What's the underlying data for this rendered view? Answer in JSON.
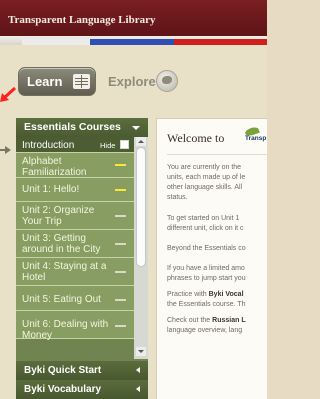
{
  "header": {
    "title": "Transparent Language Library"
  },
  "nav": {
    "learn_label": "Learn",
    "explore_label": "Explore"
  },
  "sidebar": {
    "header_label": "Essentials Courses",
    "intro": {
      "label": "Introduction",
      "hide_label": "Hide"
    },
    "lessons": [
      {
        "label": "Alphabet Familiarization",
        "complete": true
      },
      {
        "label": "Unit 1: Hello!",
        "complete": true
      },
      {
        "label": "Unit 2: Organize Your Trip",
        "complete": false
      },
      {
        "label": "Unit 3: Getting around in the City",
        "complete": false
      },
      {
        "label": "Unit 4: Staying at a Hotel",
        "complete": false
      },
      {
        "label": "Unit 5: Eating Out",
        "complete": false
      },
      {
        "label": "Unit 6: Dealing with Money",
        "complete": false
      }
    ],
    "footer_sections": [
      {
        "label": "Byki Quick Start"
      },
      {
        "label": "Byki Vocabulary"
      }
    ]
  },
  "content": {
    "welcome_text": "Welcome to",
    "logo_text": "Transp",
    "paragraphs": [
      {
        "lines": [
          "You are currently on the",
          "units, each made up of le",
          "other language skills. All",
          "status."
        ]
      },
      {
        "lines": [
          "To get started on Unit 1",
          "different unit, click on it c"
        ]
      },
      {
        "lines": [
          "Beyond the Essentials co"
        ]
      },
      {
        "lines": [
          "If you have a limited amo",
          "phrases to jump start you"
        ]
      },
      {
        "lines": [
          {
            "pre": "Practice with ",
            "bold": "Byki Vocal"
          },
          "the Essentials course. Th"
        ]
      },
      {
        "lines": [
          {
            "pre": "Check out the ",
            "bold": "Russian L"
          },
          "language overview, lang"
        ]
      }
    ]
  },
  "colors": {
    "header": "#6a191b",
    "sidebar_green": "#889d62",
    "sidebar_dark": "#4c5c33",
    "progress_done": "#ffe43a"
  }
}
